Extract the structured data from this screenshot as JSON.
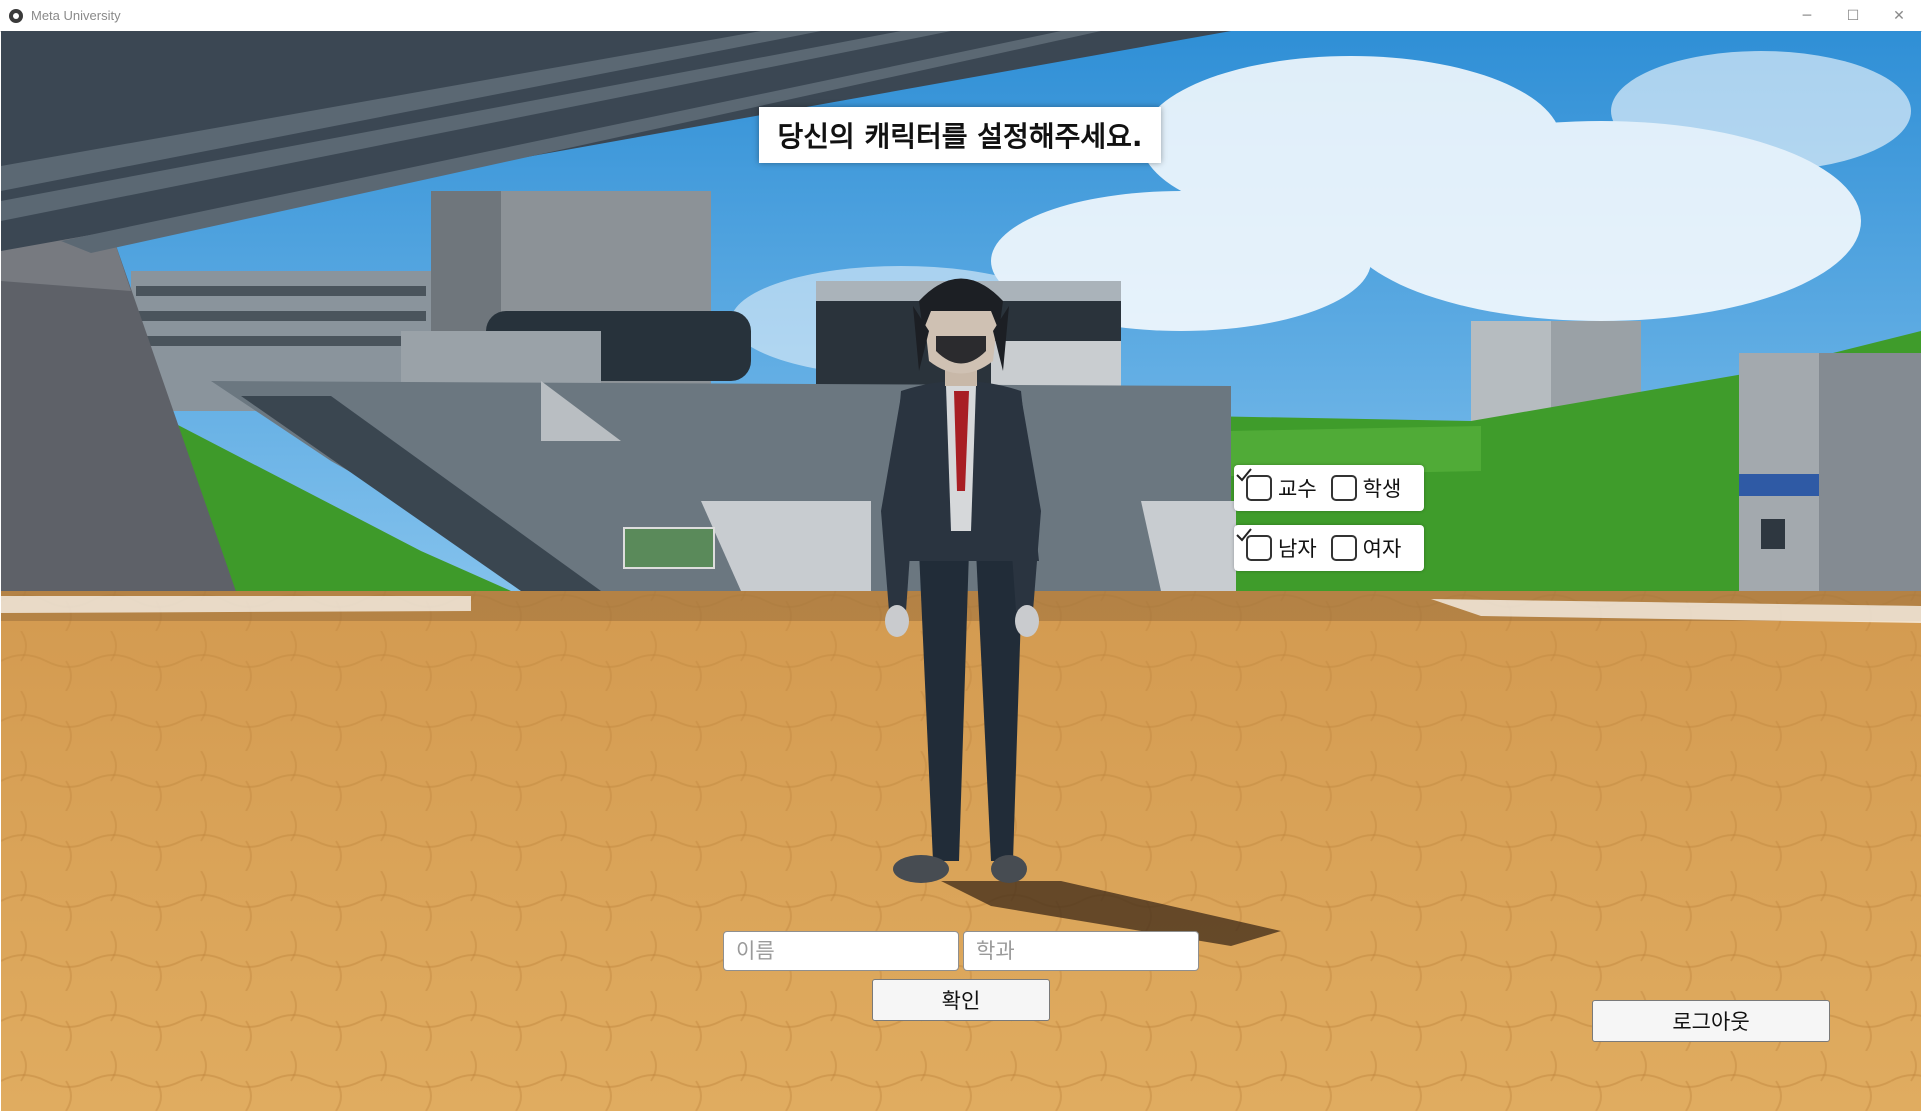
{
  "window": {
    "title": "Meta University",
    "controls": {
      "minimize": "─",
      "maximize": "☐",
      "close": "✕"
    }
  },
  "scene": {
    "banner_text": "당신의 캐릭터를 설정해주세요.",
    "role_options": [
      {
        "label": "교수",
        "checked": true
      },
      {
        "label": "학생",
        "checked": false
      }
    ],
    "gender_options": [
      {
        "label": "남자",
        "checked": true
      },
      {
        "label": "여자",
        "checked": false
      }
    ],
    "name_input": {
      "placeholder": "이름",
      "value": ""
    },
    "department_input": {
      "placeholder": "학과",
      "value": ""
    },
    "confirm_label": "확인",
    "logout_label": "로그아웃"
  },
  "colors": {
    "sky": "#4aa3df",
    "ground": "#d9a45a",
    "grass": "#3e9a2a",
    "building": "#5d6b76",
    "canopy": "#3b4753"
  }
}
